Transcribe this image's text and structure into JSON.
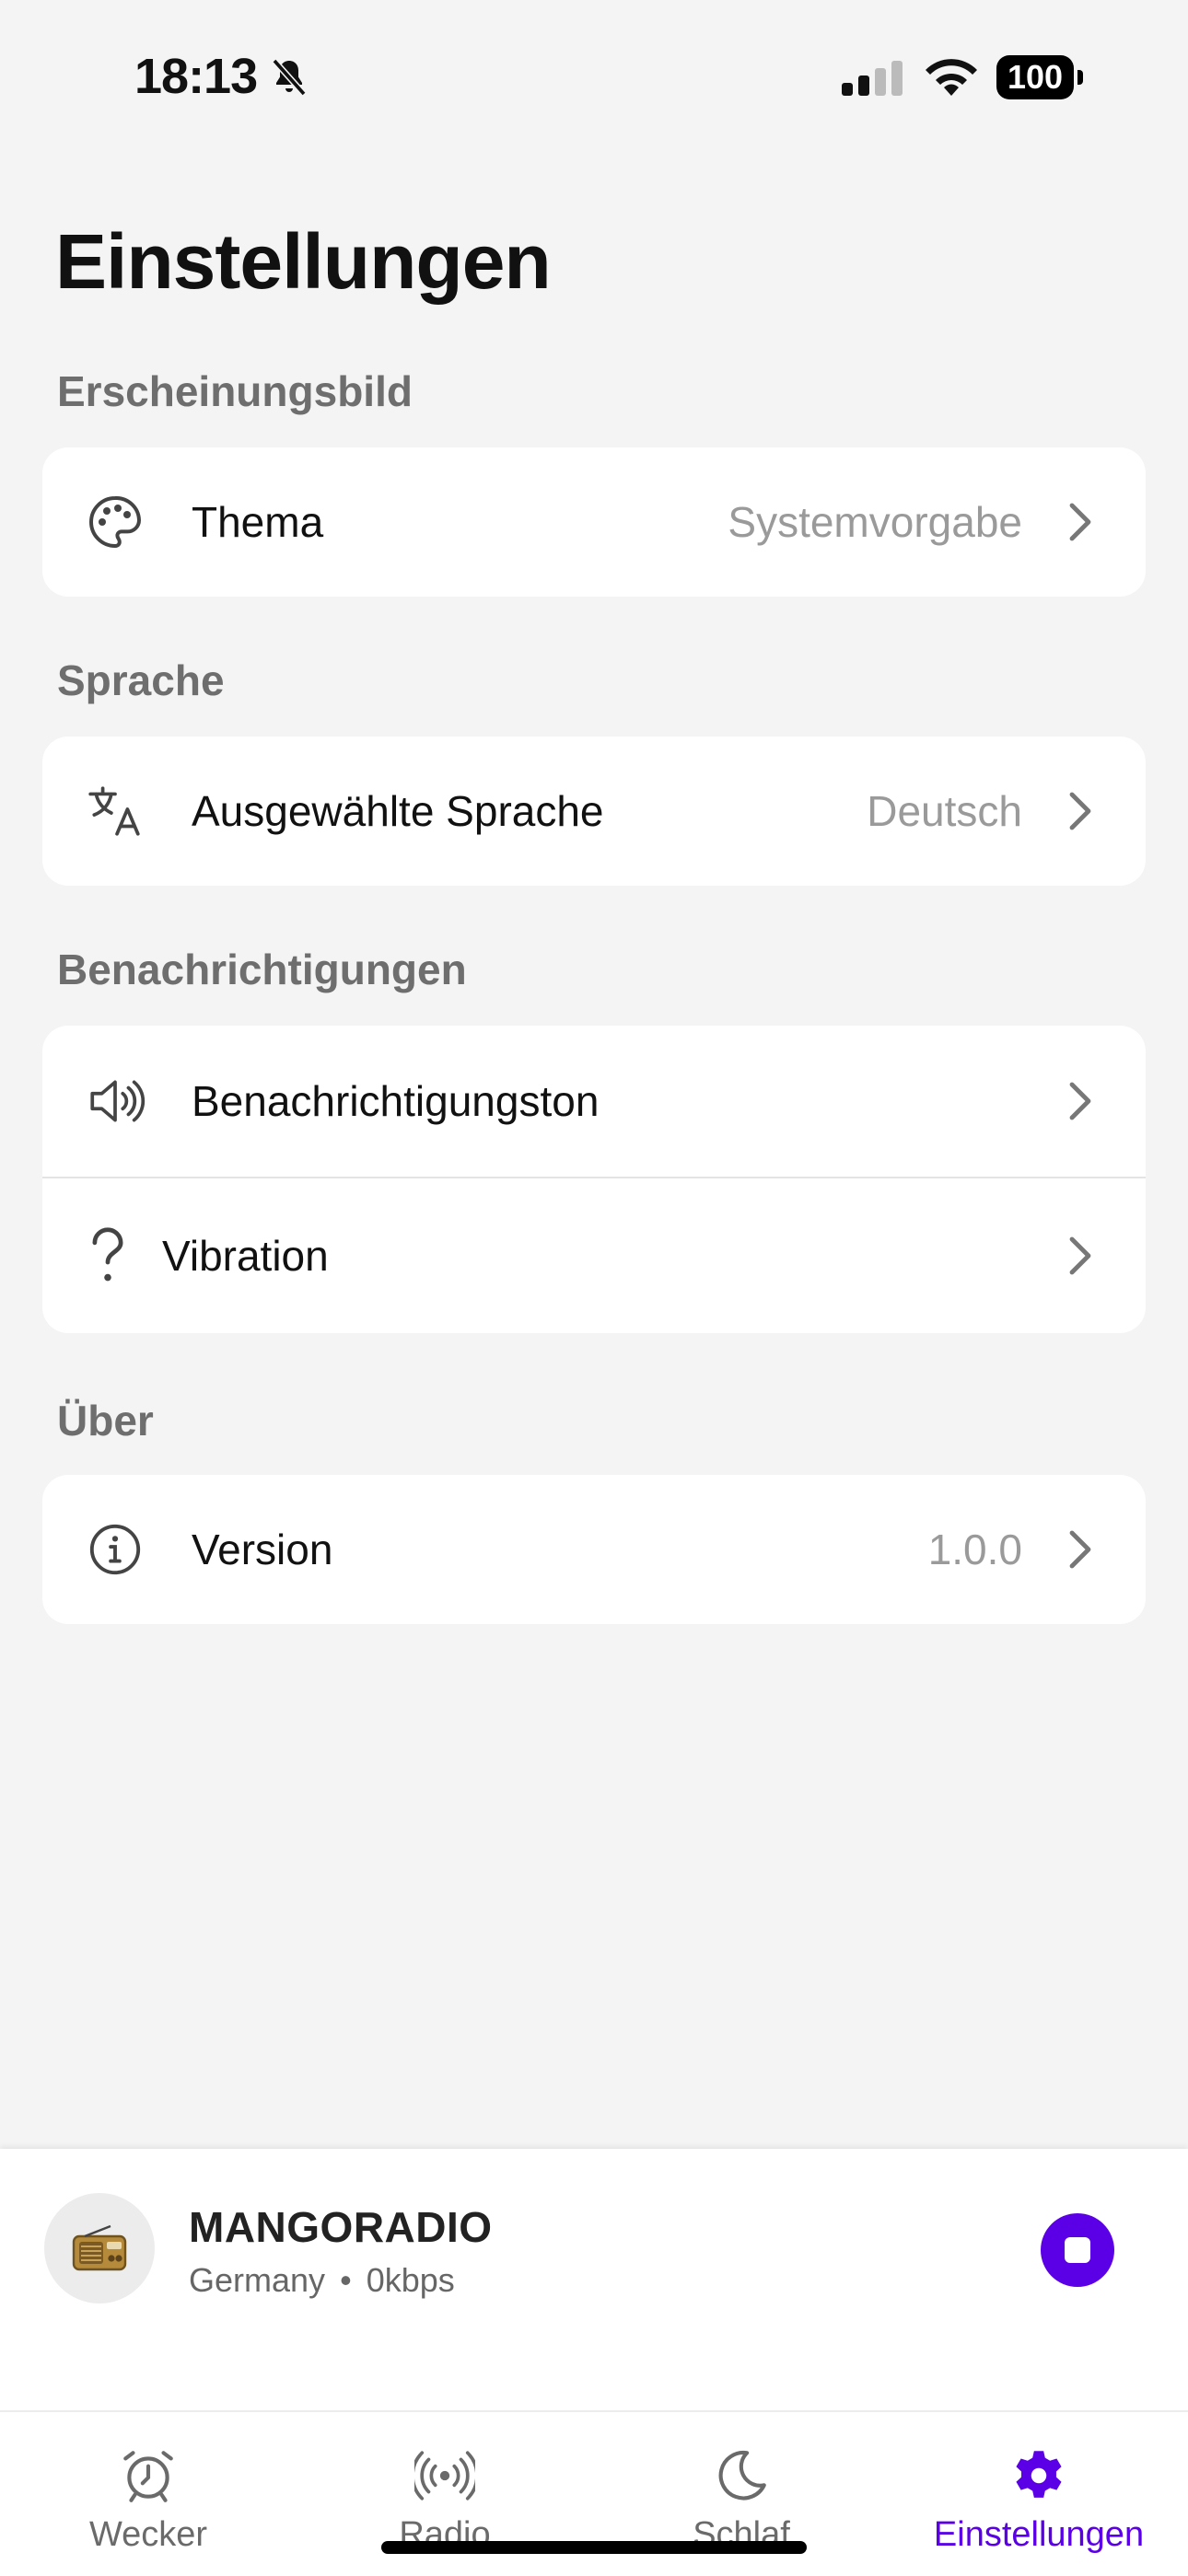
{
  "status_bar": {
    "time": "18:13",
    "battery": "100"
  },
  "page_title": "Einstellungen",
  "sections": [
    {
      "header": "Erscheinungsbild",
      "rows": [
        {
          "icon": "palette-icon",
          "label": "Thema",
          "value": "Systemvorgabe"
        }
      ]
    },
    {
      "header": "Sprache",
      "rows": [
        {
          "icon": "translate-icon",
          "label": "Ausgewählte Sprache",
          "value": "Deutsch"
        }
      ]
    },
    {
      "header": "Benachrichtigungen",
      "rows": [
        {
          "icon": "speaker-icon",
          "label": "Benachrichtigungston",
          "value": ""
        },
        {
          "icon": "question-icon",
          "label": "Vibration",
          "value": ""
        }
      ]
    },
    {
      "header": "Über",
      "rows": [
        {
          "icon": "info-icon",
          "label": "Version",
          "value": "1.0.0"
        }
      ]
    }
  ],
  "player": {
    "station_name": "MANGORADIO",
    "station_country": "Germany",
    "bitrate": "0kbps",
    "separator": "•"
  },
  "tabs": [
    {
      "label": "Wecker",
      "icon": "alarm-clock-icon",
      "active": false
    },
    {
      "label": "Radio",
      "icon": "broadcast-icon",
      "active": false
    },
    {
      "label": "Schlaf",
      "icon": "moon-icon",
      "active": false
    },
    {
      "label": "Einstellungen",
      "icon": "gear-icon",
      "active": true
    }
  ],
  "colors": {
    "accent": "#5b00e6",
    "background": "#f4f4f4",
    "card": "#ffffff",
    "secondary_text": "#9a9a9a"
  }
}
